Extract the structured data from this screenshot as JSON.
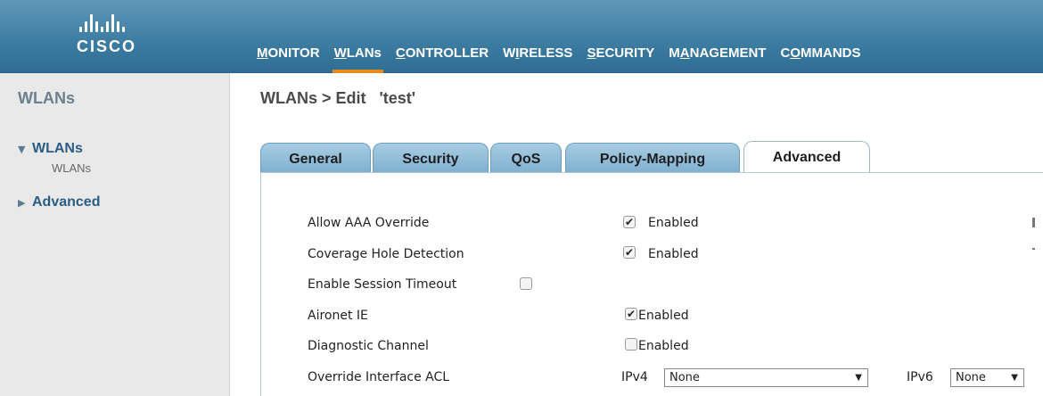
{
  "brand": {
    "name": "CISCO"
  },
  "nav": [
    {
      "pre": "",
      "ul": "M",
      "post": "ONITOR"
    },
    {
      "pre": "",
      "ul": "W",
      "post": "LANs"
    },
    {
      "pre": "",
      "ul": "C",
      "post": "ONTROLLER"
    },
    {
      "pre": "W",
      "ul": "I",
      "post": "RELESS"
    },
    {
      "pre": "",
      "ul": "S",
      "post": "ECURITY"
    },
    {
      "pre": "M",
      "ul": "A",
      "post": "NAGEMENT"
    },
    {
      "pre": "C",
      "ul": "O",
      "post": "MMANDS"
    }
  ],
  "sidebar": {
    "title": "WLANs",
    "sections": [
      {
        "label": "WLANs",
        "arrow": "▼",
        "sub": "WLANs"
      },
      {
        "label": "Advanced",
        "arrow": "▶"
      }
    ]
  },
  "page": {
    "title": "WLANs > Edit   'test'"
  },
  "tabs": [
    "General",
    "Security",
    "QoS",
    "Policy-Mapping",
    "Advanced"
  ],
  "active_tab": "Advanced",
  "settings": [
    {
      "label": "Allow AAA Override",
      "checked": true,
      "value": "Enabled"
    },
    {
      "label": "Coverage Hole Detection",
      "checked": true,
      "value": "Enabled"
    },
    {
      "label": "Enable Session Timeout",
      "checked": false,
      "value": ""
    },
    {
      "label": "Aironet IE",
      "checked": true,
      "value": "Enabled"
    },
    {
      "label": "Diagnostic Channel",
      "checked": false,
      "value": "Enabled"
    },
    {
      "label": "Override Interface ACL"
    }
  ],
  "acl": {
    "ipv4_label": "IPv4",
    "ipv4_value": "None",
    "ipv6_label": "IPv6",
    "ipv6_value": "None"
  },
  "colors": {
    "header": "#3f7ea3",
    "active_nav": "#e58b17",
    "tab": "#7fb0d0",
    "sidebar_link": "#2a5d84"
  }
}
